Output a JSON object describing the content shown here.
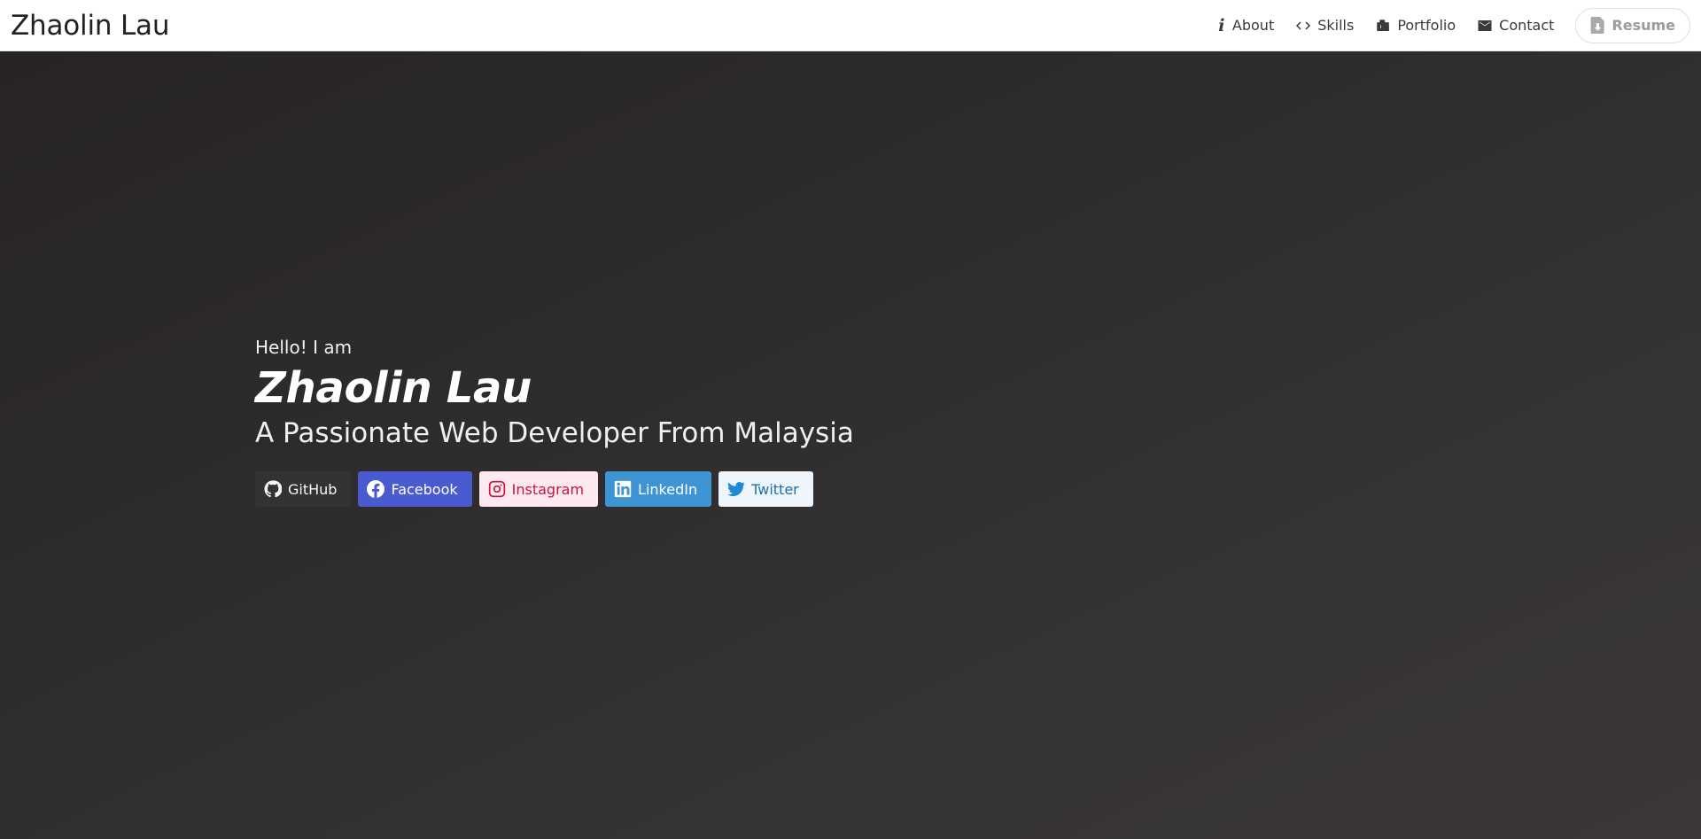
{
  "navbar": {
    "brand": "Zhaolin Lau",
    "items": [
      {
        "label": "About",
        "icon": "info-icon"
      },
      {
        "label": "Skills",
        "icon": "code-icon"
      },
      {
        "label": "Portfolio",
        "icon": "briefcase-icon"
      },
      {
        "label": "Contact",
        "icon": "envelope-icon"
      }
    ],
    "resume": {
      "label": "Resume",
      "icon": "file-download-icon"
    }
  },
  "hero": {
    "greeting": "Hello! I am",
    "name": "Zhaolin Lau",
    "tagline": "A Passionate Web Developer From Malaysia"
  },
  "socials": [
    {
      "label": "GitHub",
      "icon": "github-icon",
      "color": "#333333"
    },
    {
      "label": "Facebook",
      "icon": "facebook-icon",
      "color": "#4a5bd0"
    },
    {
      "label": "Instagram",
      "icon": "instagram-icon",
      "color": "#c8143c"
    },
    {
      "label": "LinkedIn",
      "icon": "linkedin-icon",
      "color": "#3f95d4"
    },
    {
      "label": "Twitter",
      "icon": "twitter-icon",
      "color": "#1d8ad6"
    }
  ]
}
